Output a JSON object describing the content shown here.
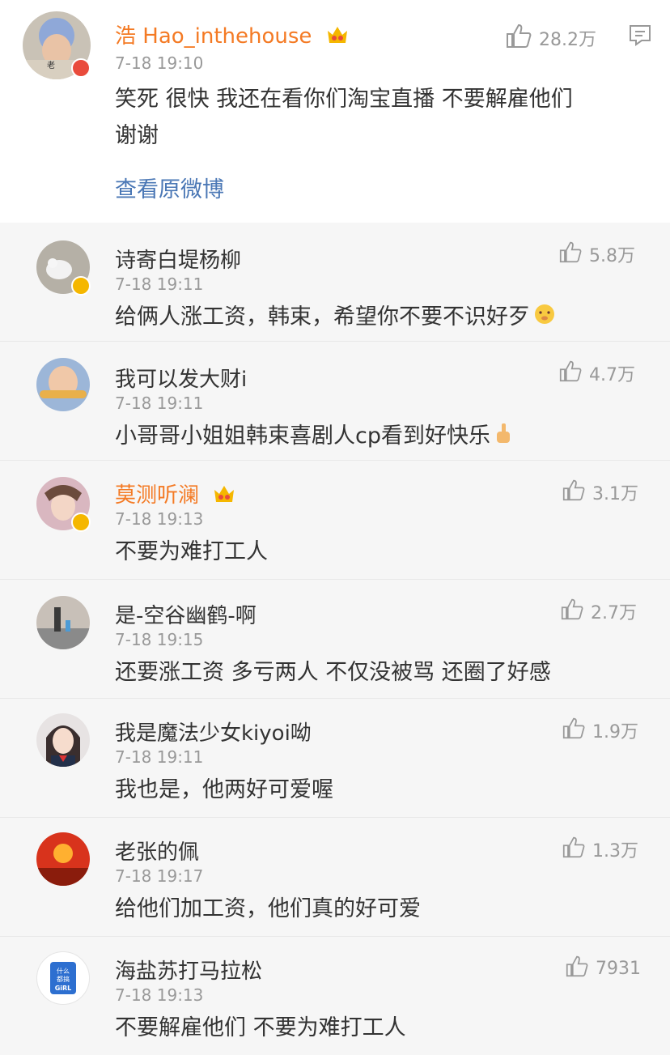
{
  "post": {
    "author": "浩 Hao_inthehouse",
    "time": "7-18 19:10",
    "text_line1": "笑死 很快 我还在看你们淘宝直播 不要解雇他们",
    "text_line2": "谢谢",
    "likes": "28.2万",
    "view_original": "查看原微博"
  },
  "comments": [
    {
      "name": "诗寄白堤杨柳",
      "time": "7-18 19:11",
      "text": "给俩人涨工资，韩束，希望你不要不识好歹",
      "likes": "5.8万",
      "name_color": "plain"
    },
    {
      "name": "我可以发大财i",
      "time": "7-18 19:11",
      "text": "小哥哥小姐姐韩束喜剧人cp看到好快乐",
      "likes": "4.7万",
      "name_color": "plain"
    },
    {
      "name": "莫测听澜",
      "time": "7-18 19:13",
      "text": "不要为难打工人",
      "likes": "3.1万",
      "name_color": "orange"
    },
    {
      "name": "是-空谷幽鹤-啊",
      "time": "7-18 19:15",
      "text": "还要涨工资 多亏两人 不仅没被骂 还圈了好感",
      "likes": "2.7万",
      "name_color": "plain"
    },
    {
      "name": "我是魔法少女kiyoi呦",
      "time": "7-18 19:11",
      "text": "我也是，他两好可爱喔",
      "likes": "1.9万",
      "name_color": "plain"
    },
    {
      "name": "老张的佩",
      "time": "7-18 19:17",
      "text": "给他们加工资，他们真的好可爱",
      "likes": "1.3万",
      "name_color": "plain"
    },
    {
      "name": "海盐苏打马拉松",
      "time": "7-18 19:13",
      "text": "不要解雇他们 不要为难打工人",
      "likes": "7931",
      "name_color": "plain"
    }
  ],
  "avatar_labels": {
    "c7_line1": "什么",
    "c7_line2": "都搞",
    "c7_line3": "GiRL"
  },
  "colors": {
    "orange": "#f47a24",
    "link": "#4a77b5",
    "gold": "#f5b700",
    "muted": "#999999"
  }
}
